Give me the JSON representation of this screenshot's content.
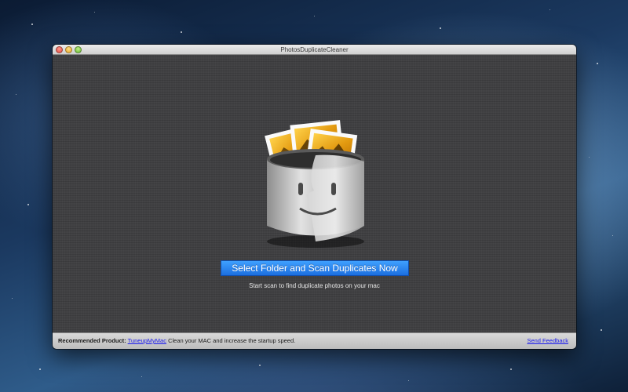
{
  "window": {
    "title": "PhotosDuplicateCleaner"
  },
  "main": {
    "scan_button_label": "Select Folder and Scan Duplicates Now",
    "hint_text": "Start scan to find duplicate photos on your mac",
    "app_icon": "photos-duplicate-cleaner-app-icon"
  },
  "footer": {
    "recommended_label": "Recommended Product:",
    "product_link": "TuneupMyMac",
    "product_description": "Clean your MAC and increase the startup speed.",
    "feedback_link": "Send Feedback"
  },
  "colors": {
    "button_blue": "#2a83f0",
    "panel_gray": "#414143",
    "link_blue": "#1a1aee"
  }
}
